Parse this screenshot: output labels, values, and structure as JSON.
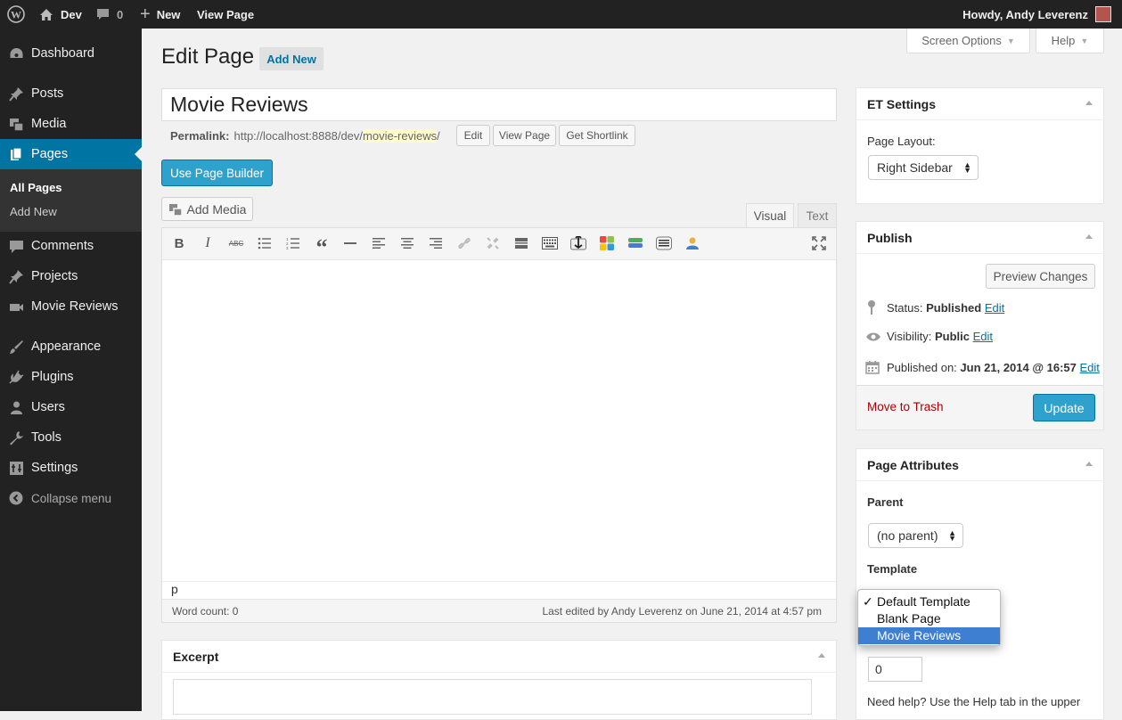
{
  "adminbar": {
    "site": "Dev",
    "comments": "0",
    "new": "New",
    "view": "View Page",
    "howdy": "Howdy, Andy Leverenz"
  },
  "menu": {
    "dashboard": "Dashboard",
    "posts": "Posts",
    "media": "Media",
    "pages": "Pages",
    "all_pages": "All Pages",
    "add_new": "Add New",
    "comments": "Comments",
    "projects": "Projects",
    "movie_reviews": "Movie Reviews",
    "appearance": "Appearance",
    "plugins": "Plugins",
    "users": "Users",
    "tools": "Tools",
    "settings": "Settings",
    "collapse": "Collapse menu"
  },
  "screen_options": "Screen Options",
  "help": "Help",
  "page": {
    "heading": "Edit Page",
    "add_new": "Add New",
    "title": "Movie Reviews"
  },
  "permalink": {
    "label": "Permalink:",
    "base": "http://localhost:8888/dev/",
    "slug": "movie-reviews",
    "end": "/",
    "edit": "Edit",
    "view": "View Page",
    "shortlink": "Get Shortlink"
  },
  "builder": "Use Page Builder",
  "editor": {
    "add_media": "Add Media",
    "tab_visual": "Visual",
    "tab_text": "Text",
    "path": "p",
    "word_count": "Word count: 0",
    "last_edited": "Last edited by Andy Leverenz on June 21, 2014 at 4:57 pm"
  },
  "excerpt": {
    "title": "Excerpt"
  },
  "et": {
    "title": "ET Settings",
    "layout_label": "Page Layout:",
    "layout_value": "Right Sidebar"
  },
  "publish": {
    "title": "Publish",
    "preview": "Preview Changes",
    "status_label": "Status:",
    "status_value": "Published",
    "visibility_label": "Visibility:",
    "visibility_value": "Public",
    "published_label": "Published on:",
    "published_value": "Jun 21, 2014 @ 16:57",
    "edit": "Edit",
    "trash": "Move to Trash",
    "update": "Update"
  },
  "attributes": {
    "title": "Page Attributes",
    "parent_label": "Parent",
    "parent_value": "(no parent)",
    "template_label": "Template",
    "template_options": [
      "Default Template",
      "Blank Page",
      "Movie Reviews"
    ],
    "checkmark": "✓",
    "order_value": "0",
    "help": "Need help? Use the Help tab in the upper"
  },
  "colors": {
    "accent": "#0074a2",
    "button": "#2ea2cc",
    "trash": "#a00"
  }
}
